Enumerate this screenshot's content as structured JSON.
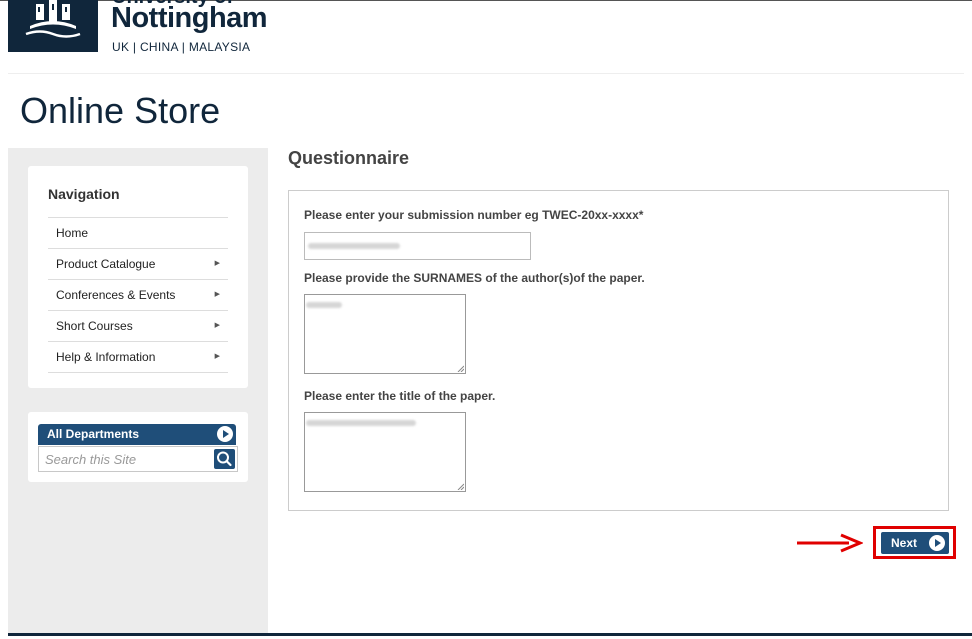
{
  "header": {
    "university_partial": "University of",
    "university_name": "Nottingham",
    "campuses": "UK | CHINA | MALAYSIA"
  },
  "page": {
    "title": "Online Store"
  },
  "sidebar": {
    "nav_title": "Navigation",
    "items": [
      {
        "label": "Home",
        "has_arrow": false
      },
      {
        "label": "Product Catalogue",
        "has_arrow": true
      },
      {
        "label": "Conferences & Events",
        "has_arrow": true
      },
      {
        "label": "Short Courses",
        "has_arrow": true
      },
      {
        "label": "Help & Information",
        "has_arrow": true
      }
    ],
    "departments_label": "All Departments",
    "search_placeholder": "Search this Site"
  },
  "questionnaire": {
    "title": "Questionnaire",
    "q1_label": "Please enter your submission number eg TWEC-20xx-xxxx*",
    "q2_label": "Please provide the SURNAMES of the author(s)of the paper.",
    "q3_label": "Please enter the title of the paper.",
    "next_label": "Next"
  },
  "colors": {
    "brand_navy": "#10263b",
    "button_blue": "#1f4e79",
    "highlight_red": "#e00000",
    "sidebar_grey": "#ececec"
  }
}
